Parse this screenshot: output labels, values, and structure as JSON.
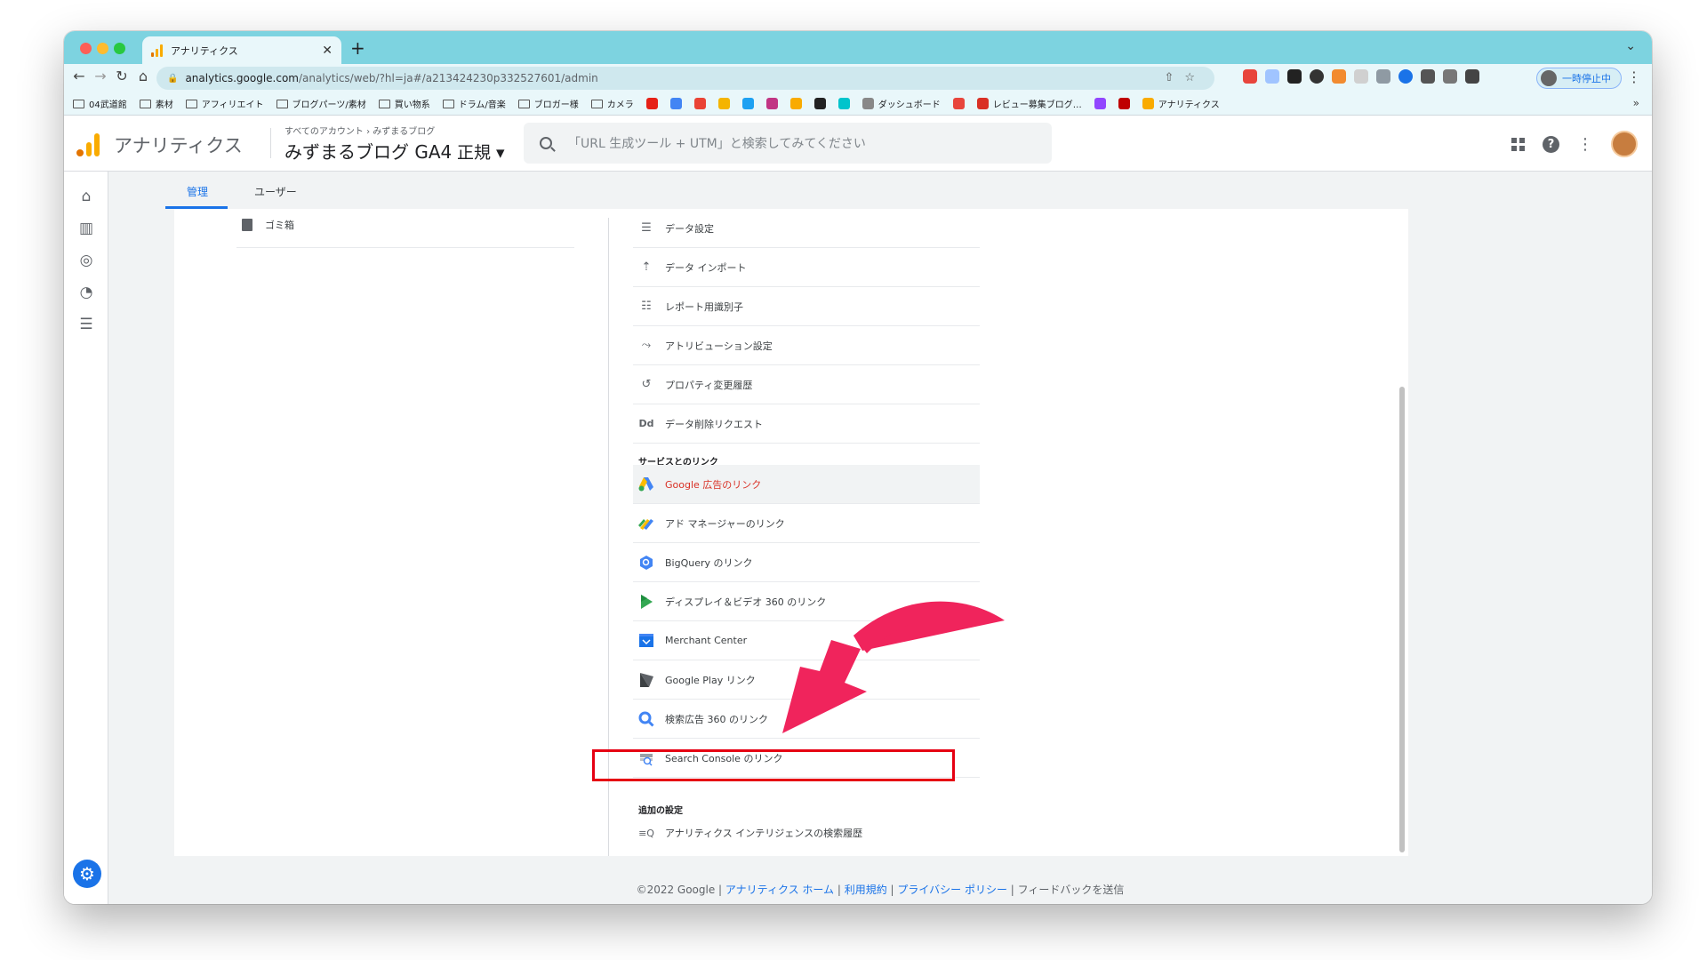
{
  "browser": {
    "tab_title": "アナリティクス",
    "url_host": "analytics.google.com",
    "url_path": "/analytics/web/?hl=ja#/a213424230p332527601/admin",
    "profile_label": "一時停止中",
    "bookmarks": [
      "04武道館",
      "素材",
      "アフィリエイト",
      "ブログパーツ/素材",
      "買い物系",
      "ドラム/音楽",
      "ブロガー様",
      "カメラ",
      "ダッシュボード",
      "レビュー募集ブログ…",
      "アナリティクス"
    ],
    "bookmarks_more": "»"
  },
  "ga": {
    "product": "アナリティクス",
    "crumb": "すべてのアカウント › みずまるブログ",
    "account": "みずまるブログ GA4",
    "view": "正規",
    "search_placeholder": "「URL 生成ツール + UTM」と検索してみてください"
  },
  "admin_tabs": {
    "admin": "管理",
    "user": "ユーザー"
  },
  "left_column": {
    "trash": "ゴミ箱"
  },
  "menu": {
    "items_top": [
      {
        "label": "データ設定",
        "icon": "database-icon"
      },
      {
        "label": "データ インポート",
        "icon": "upload-icon"
      },
      {
        "label": "レポート用識別子",
        "icon": "identifier-icon"
      },
      {
        "label": "アトリビューション設定",
        "icon": "attribution-icon"
      },
      {
        "label": "プロパティ変更履歴",
        "icon": "history-icon"
      },
      {
        "label": "データ削除リクエスト",
        "icon": "data-delete-icon"
      }
    ],
    "section_links": "サービスとのリンク",
    "links": [
      {
        "label": "Google 広告のリンク",
        "icon": "google-ads-icon"
      },
      {
        "label": "アド マネージャーのリンク",
        "icon": "ad-manager-icon"
      },
      {
        "label": "BigQuery のリンク",
        "icon": "bigquery-icon"
      },
      {
        "label": "ディスプレイ＆ビデオ 360 のリンク",
        "icon": "dv360-icon"
      },
      {
        "label": "Merchant Center",
        "icon": "merchant-center-icon"
      },
      {
        "label": "Google Play リンク",
        "icon": "google-play-icon"
      },
      {
        "label": "検索広告 360 のリンク",
        "icon": "search-ads-360-icon"
      },
      {
        "label": "Search Console のリンク",
        "icon": "search-console-icon"
      }
    ],
    "section_additional": "追加の設定",
    "additional": [
      {
        "label": "アナリティクス インテリジェンスの検索履歴",
        "icon": "intelligence-history-icon"
      }
    ]
  },
  "footer": {
    "copyright": "©2022 Google | ",
    "home": "アナリティクス ホーム",
    "terms": "利用規約",
    "privacy": "プライバシー ポリシー",
    "feedback": "フィードバックを送信"
  },
  "colors": {
    "accent": "#1a73e8",
    "highlight": "#e60012",
    "arrow": "#f0245c"
  }
}
